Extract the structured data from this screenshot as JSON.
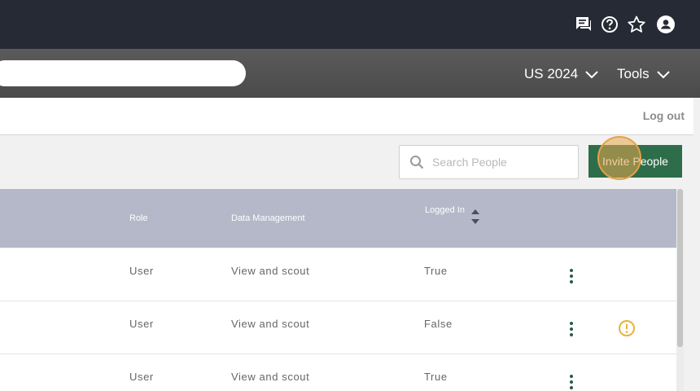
{
  "topbar": {
    "icons": [
      "feedback-icon",
      "help-icon",
      "star-icon",
      "account-icon"
    ]
  },
  "navbar": {
    "season_label": "US 2024",
    "tools_label": "Tools"
  },
  "subbar": {
    "logout_label": "Log out"
  },
  "people": {
    "search_placeholder": "Search People",
    "invite_label": "Invite People"
  },
  "table": {
    "columns": {
      "role": "Role",
      "data_management": "Data Management",
      "logged_in": "Logged In"
    },
    "rows": [
      {
        "role": "User",
        "data_management": "View and scout",
        "logged_in": "True",
        "warning": false
      },
      {
        "role": "User",
        "data_management": "View and scout",
        "logged_in": "False",
        "warning": true
      },
      {
        "role": "User",
        "data_management": "View and scout",
        "logged_in": "True",
        "warning": false
      }
    ]
  },
  "colors": {
    "topbar": "#262a35",
    "accent_green": "#2e6d49",
    "table_header": "#b4b8c8",
    "warning": "#e8b23a"
  }
}
